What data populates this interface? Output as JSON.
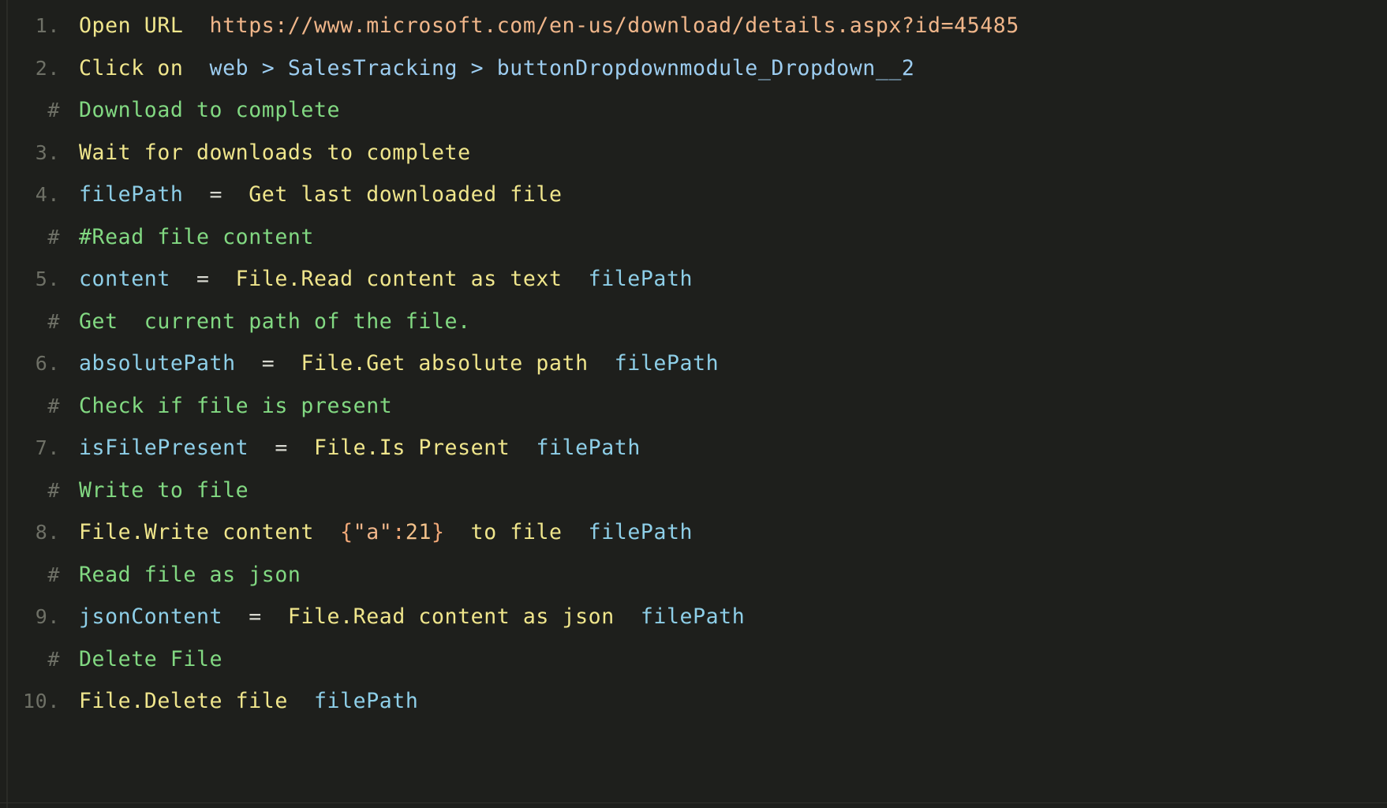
{
  "editor": {
    "background": "#1e1f1c",
    "font_size_px": 26.5,
    "line_height_px": 53.5
  },
  "palette": {
    "line_number": "#6e7066",
    "comment_hash": "#6e7066",
    "keyword": "#f0e68c",
    "variable": "#8ecfe8",
    "comment": "#82d982",
    "url_string": "#f0b68a",
    "selector": "#9dcdf0",
    "operator": "#d8d8d0",
    "json_brace": "#f0a878",
    "json_key": "#f0b68a",
    "json_number": "#f0c08a"
  },
  "lines": [
    {
      "gutter": "1.",
      "kind": "step",
      "tokens": [
        {
          "text": "Open URL",
          "color": "#f0e68c"
        },
        {
          "text": "  ",
          "color": "#d8d8d0"
        },
        {
          "text": "https://www.microsoft.com/en-us/download/details.aspx?id=45485",
          "color": "#f0b68a"
        }
      ]
    },
    {
      "gutter": "2.",
      "kind": "step",
      "tokens": [
        {
          "text": "Click on",
          "color": "#f0e68c"
        },
        {
          "text": "  ",
          "color": "#d8d8d0"
        },
        {
          "text": "web > SalesTracking > buttonDropdownmodule_Dropdown__2",
          "color": "#9dcdf0"
        }
      ]
    },
    {
      "gutter": "#",
      "kind": "comment",
      "tokens": [
        {
          "text": "Download to complete",
          "color": "#82d982"
        }
      ]
    },
    {
      "gutter": "3.",
      "kind": "step",
      "tokens": [
        {
          "text": "Wait for downloads to complete",
          "color": "#f0e68c"
        }
      ]
    },
    {
      "gutter": "4.",
      "kind": "step",
      "tokens": [
        {
          "text": "filePath",
          "color": "#8ecfe8"
        },
        {
          "text": "  ",
          "color": "#d8d8d0"
        },
        {
          "text": "=",
          "color": "#d8d8d0"
        },
        {
          "text": "  ",
          "color": "#d8d8d0"
        },
        {
          "text": "Get last downloaded file",
          "color": "#f0e68c"
        }
      ]
    },
    {
      "gutter": "#",
      "kind": "comment",
      "tokens": [
        {
          "text": "#Read file content",
          "color": "#82d982"
        }
      ]
    },
    {
      "gutter": "5.",
      "kind": "step",
      "tokens": [
        {
          "text": "content",
          "color": "#8ecfe8"
        },
        {
          "text": "  ",
          "color": "#d8d8d0"
        },
        {
          "text": "=",
          "color": "#d8d8d0"
        },
        {
          "text": "  ",
          "color": "#d8d8d0"
        },
        {
          "text": "File.Read content as text",
          "color": "#f0e68c"
        },
        {
          "text": "  ",
          "color": "#d8d8d0"
        },
        {
          "text": "filePath",
          "color": "#8ecfe8"
        }
      ]
    },
    {
      "gutter": "#",
      "kind": "comment",
      "tokens": [
        {
          "text": "Get  current path of the file.",
          "color": "#82d982"
        }
      ]
    },
    {
      "gutter": "6.",
      "kind": "step",
      "tokens": [
        {
          "text": "absolutePath",
          "color": "#8ecfe8"
        },
        {
          "text": "  ",
          "color": "#d8d8d0"
        },
        {
          "text": "=",
          "color": "#d8d8d0"
        },
        {
          "text": "  ",
          "color": "#d8d8d0"
        },
        {
          "text": "File.Get absolute path",
          "color": "#f0e68c"
        },
        {
          "text": "  ",
          "color": "#d8d8d0"
        },
        {
          "text": "filePath",
          "color": "#8ecfe8"
        }
      ]
    },
    {
      "gutter": "#",
      "kind": "comment",
      "tokens": [
        {
          "text": "Check if file is present",
          "color": "#82d982"
        }
      ]
    },
    {
      "gutter": "7.",
      "kind": "step",
      "tokens": [
        {
          "text": "isFilePresent",
          "color": "#8ecfe8"
        },
        {
          "text": "  ",
          "color": "#d8d8d0"
        },
        {
          "text": "=",
          "color": "#d8d8d0"
        },
        {
          "text": "  ",
          "color": "#d8d8d0"
        },
        {
          "text": "File.Is Present",
          "color": "#f0e68c"
        },
        {
          "text": "  ",
          "color": "#d8d8d0"
        },
        {
          "text": "filePath",
          "color": "#8ecfe8"
        }
      ]
    },
    {
      "gutter": "#",
      "kind": "comment",
      "tokens": [
        {
          "text": "Write to file",
          "color": "#82d982"
        }
      ]
    },
    {
      "gutter": "8.",
      "kind": "step",
      "tokens": [
        {
          "text": "File.Write content",
          "color": "#f0e68c"
        },
        {
          "text": "  ",
          "color": "#d8d8d0"
        },
        {
          "text": "{",
          "color": "#f0a878"
        },
        {
          "text": "\"a\"",
          "color": "#f0b68a"
        },
        {
          "text": ":",
          "color": "#f0a878"
        },
        {
          "text": "21",
          "color": "#f0c08a"
        },
        {
          "text": "}",
          "color": "#f0a878"
        },
        {
          "text": "  ",
          "color": "#d8d8d0"
        },
        {
          "text": "to file",
          "color": "#f0e68c"
        },
        {
          "text": "  ",
          "color": "#d8d8d0"
        },
        {
          "text": "filePath",
          "color": "#8ecfe8"
        }
      ]
    },
    {
      "gutter": "#",
      "kind": "comment",
      "tokens": [
        {
          "text": "Read file as json",
          "color": "#82d982"
        }
      ]
    },
    {
      "gutter": "9.",
      "kind": "step",
      "tokens": [
        {
          "text": "jsonContent",
          "color": "#8ecfe8"
        },
        {
          "text": "  ",
          "color": "#d8d8d0"
        },
        {
          "text": "=",
          "color": "#d8d8d0"
        },
        {
          "text": "  ",
          "color": "#d8d8d0"
        },
        {
          "text": "File.Read content as json",
          "color": "#f0e68c"
        },
        {
          "text": "  ",
          "color": "#d8d8d0"
        },
        {
          "text": "filePath",
          "color": "#8ecfe8"
        }
      ]
    },
    {
      "gutter": "#",
      "kind": "comment",
      "tokens": [
        {
          "text": "Delete File",
          "color": "#82d982"
        }
      ]
    },
    {
      "gutter": "10.",
      "kind": "step",
      "tokens": [
        {
          "text": "File.Delete file",
          "color": "#f0e68c"
        },
        {
          "text": "  ",
          "color": "#d8d8d0"
        },
        {
          "text": "filePath",
          "color": "#8ecfe8"
        }
      ]
    }
  ]
}
